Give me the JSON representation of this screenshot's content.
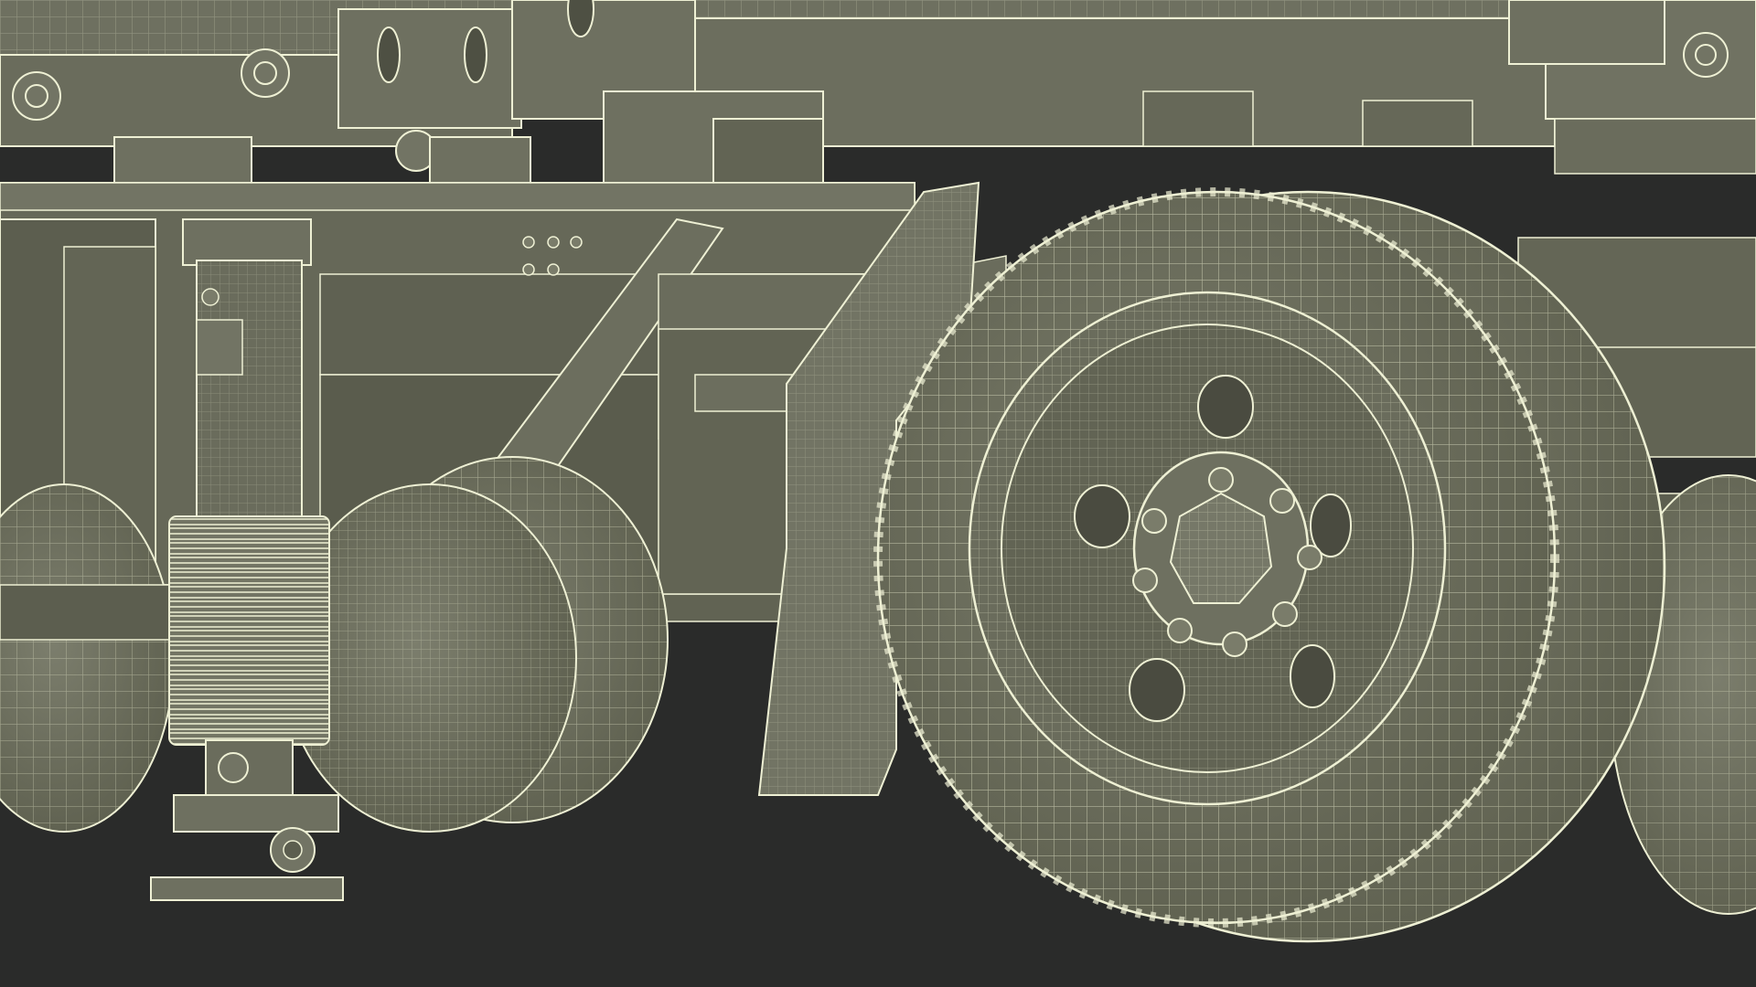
{
  "scene": {
    "subject": "wireframe-render-trailer-undercarriage",
    "colors": {
      "ground": "#2a2b2a",
      "surface": "#6e7060",
      "surface_light": "#7e8070",
      "surface_dark": "#565849",
      "shadow": "#4a4b40",
      "wire": "#eef0d4",
      "wire_faint": "#d8dabf"
    },
    "elements": [
      "chassis-frame",
      "cross-beam",
      "landing-gear-leg",
      "bellows-boot",
      "foot-pad",
      "mud-flap",
      "dual-rear-wheel",
      "wheel-hub",
      "lug-nut",
      "rear-left-wheels",
      "far-right-wheel"
    ]
  }
}
